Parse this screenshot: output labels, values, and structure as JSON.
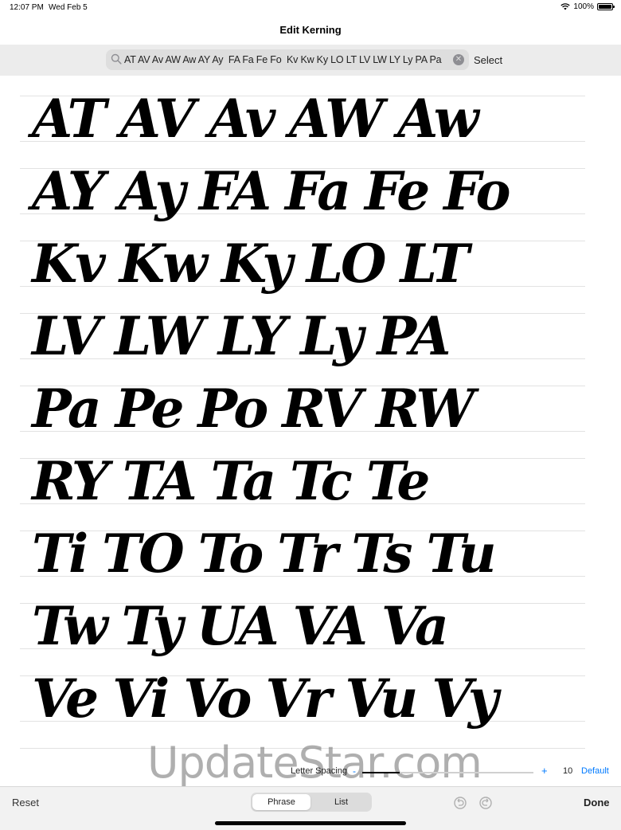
{
  "status_bar": {
    "time": "12:07 PM",
    "date": "Wed Feb 5",
    "battery": "100%"
  },
  "nav": {
    "title": "Edit Kerning"
  },
  "search": {
    "value": "AT AV Av AW Aw AY Ay  FA Fa Fe Fo  Kv Kw Ky LO LT LV LW LY Ly PA Pa",
    "select_label": "Select"
  },
  "kerning_rows": [
    "AT AV Av AW Aw",
    "AY Ay  FA Fa Fe Fo",
    "Kv Kw Ky LO LT",
    "LV LW LY Ly PA",
    "Pa Pe Po RV RW",
    "RY TA Ta Tc Te",
    "Ti TO To Tr Ts Tu",
    "Tw Ty UA VA Va",
    "Ve Vi Vo Vr Vu Vy"
  ],
  "watermark": "UpdateStar.com",
  "letter_spacing": {
    "label": "Letter Spacing",
    "minus": "-",
    "plus": "+",
    "value": "10",
    "default_label": "Default",
    "slider_fraction": 0.22
  },
  "toolbar": {
    "reset_label": "Reset",
    "segments": [
      "Phrase",
      "List"
    ],
    "selected_segment": "Phrase",
    "done_label": "Done"
  },
  "colors": {
    "accent": "#007aff",
    "background": "#ffffff",
    "toolbar": "#f2f2f2"
  }
}
